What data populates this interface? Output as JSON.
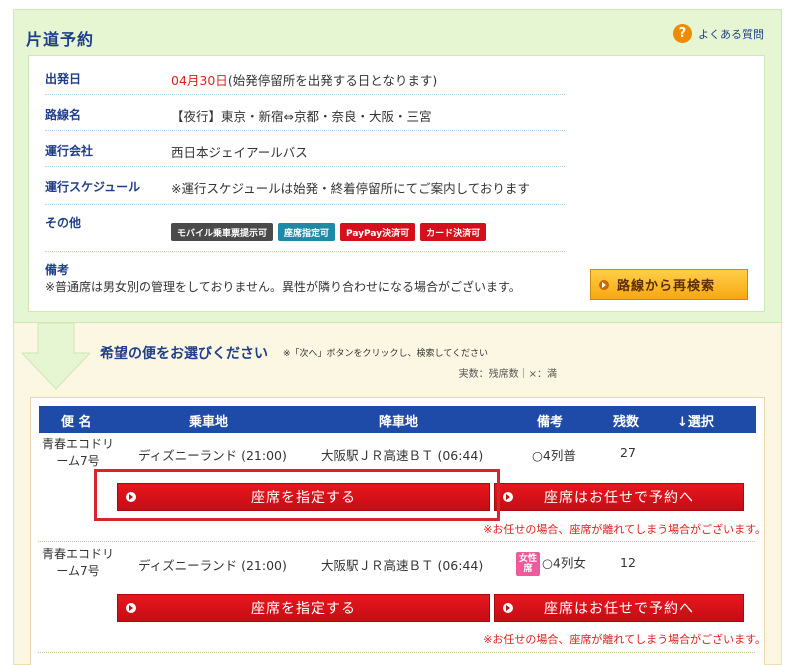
{
  "header": {
    "title": "片道予約",
    "faq_label": "よくある質問",
    "faq_icon": "question-icon"
  },
  "info": {
    "departure_label": "出発日",
    "departure_date": "04月30日",
    "departure_note": "(始発停留所を出発する日となります)",
    "route_label": "路線名",
    "route_value": "【夜行】東京・新宿⇔京都・奈良・大阪・三宮",
    "company_label": "運行会社",
    "company_value": "西日本ジェイアールバス",
    "schedule_label": "運行スケジュール",
    "schedule_value": "※運行スケジュールは始発・終着停留所にてご案内しております",
    "other_label": "その他",
    "badges": [
      "モバイル乗車票提示可",
      "座席指定可",
      "PayPay決済可",
      "カード決済可"
    ],
    "remarks_label": "備考",
    "remarks_value": "※普通席は男女別の管理をしておりません。異性が隣り合わせになる場合がございます。",
    "research_button": "路線から再検索"
  },
  "selection": {
    "title": "希望の便をお選びください",
    "note": "※「次へ」ボタンをクリックし、検索してください",
    "legend": "実数：残席数｜×：満"
  },
  "table": {
    "headers": [
      "便 名",
      "乗車地",
      "降車地",
      "備考",
      "残数",
      "↓選択"
    ],
    "rows": [
      {
        "bus_name_line1": "青春エコドリ",
        "bus_name_line2": "ーム7号",
        "boarding": "ディズニーランド (21:00)",
        "alighting": "大阪駅ＪＲ高速ＢＴ (06:44)",
        "remark": "○4列普",
        "remaining": "27",
        "female_badge": "",
        "select_seat_button": "座席を指定する",
        "auto_seat_button": "座席はお任せで予約へ",
        "warning": "※お任せの場合、座席が離れてしまう場合がございます。"
      },
      {
        "bus_name_line1": "青春エコドリ",
        "bus_name_line2": "ーム7号",
        "boarding": "ディズニーランド (21:00)",
        "alighting": "大阪駅ＪＲ高速ＢＴ (06:44)",
        "remark": "○4列女",
        "remaining": "12",
        "female_badge": "女性席",
        "select_seat_button": "座席を指定する",
        "auto_seat_button": "座席はお任せで予約へ",
        "warning": "※お任せの場合、座席が離れてしまう場合がございます。"
      }
    ]
  },
  "colors": {
    "accent_blue": "#1e4aa8",
    "button_red": "#d5101a",
    "orange": "#f7a712",
    "green_bg": "#e6f6d2"
  }
}
